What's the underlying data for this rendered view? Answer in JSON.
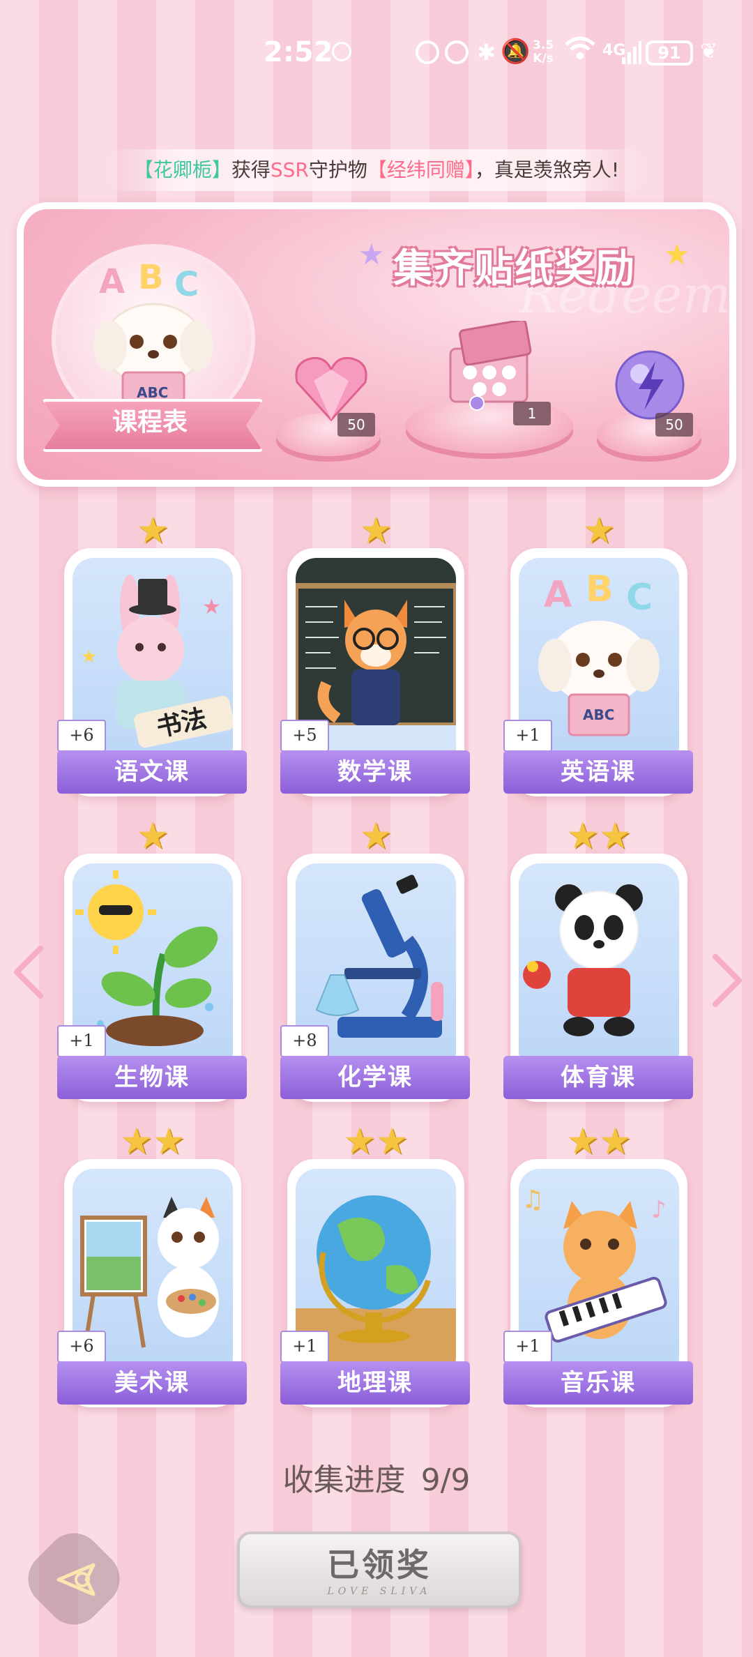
{
  "status_bar": {
    "time": "2:52",
    "speed": "3.5\nK/s",
    "network": "4G",
    "battery": "91"
  },
  "ticker": {
    "part1": "【花卿栀】",
    "part2": "获得",
    "part3": "SSR",
    "part4": "守护物",
    "part5": "【经纬同赠】",
    "part6": "，真是羡煞旁人!"
  },
  "banner": {
    "title": "集齐贴纸奖励",
    "watermark": "Redeem",
    "schedule_label": "课程表",
    "rewards": [
      {
        "icon": "pink-heart-diamond-icon",
        "count": "50"
      },
      {
        "icon": "gift-box-icon",
        "count": "1"
      },
      {
        "icon": "purple-energy-orb-icon",
        "count": "50"
      }
    ]
  },
  "courses": [
    {
      "name": "语文课",
      "count": "+6",
      "stars": "★",
      "icon": "rabbit-calligraphy-icon"
    },
    {
      "name": "数学课",
      "count": "+5",
      "stars": "★",
      "icon": "fox-teacher-icon"
    },
    {
      "name": "英语课",
      "count": "+1",
      "stars": "★",
      "icon": "puppy-abc-icon"
    },
    {
      "name": "生物课",
      "count": "+1",
      "stars": "★",
      "icon": "sun-sprout-icon"
    },
    {
      "name": "化学课",
      "count": "+8",
      "stars": "★",
      "icon": "microscope-icon"
    },
    {
      "name": "体育课",
      "count": "",
      "stars": "★★",
      "icon": "panda-pingpong-icon"
    },
    {
      "name": "美术课",
      "count": "+6",
      "stars": "★★",
      "icon": "cat-painter-icon"
    },
    {
      "name": "地理课",
      "count": "+1",
      "stars": "★★",
      "icon": "globe-icon"
    },
    {
      "name": "音乐课",
      "count": "+1",
      "stars": "★★",
      "icon": "cat-keyboard-icon"
    }
  ],
  "progress": {
    "label": "收集进度",
    "value": "9/9"
  },
  "claimed_button": {
    "label": "已领奖",
    "sub": "LOVE SLIVA"
  },
  "colors": {
    "stripe_light": "#fbdbe4",
    "stripe_dark": "#f7cbd7",
    "label_purple": "#8b5fd8",
    "star_gold": "#f5c542"
  }
}
